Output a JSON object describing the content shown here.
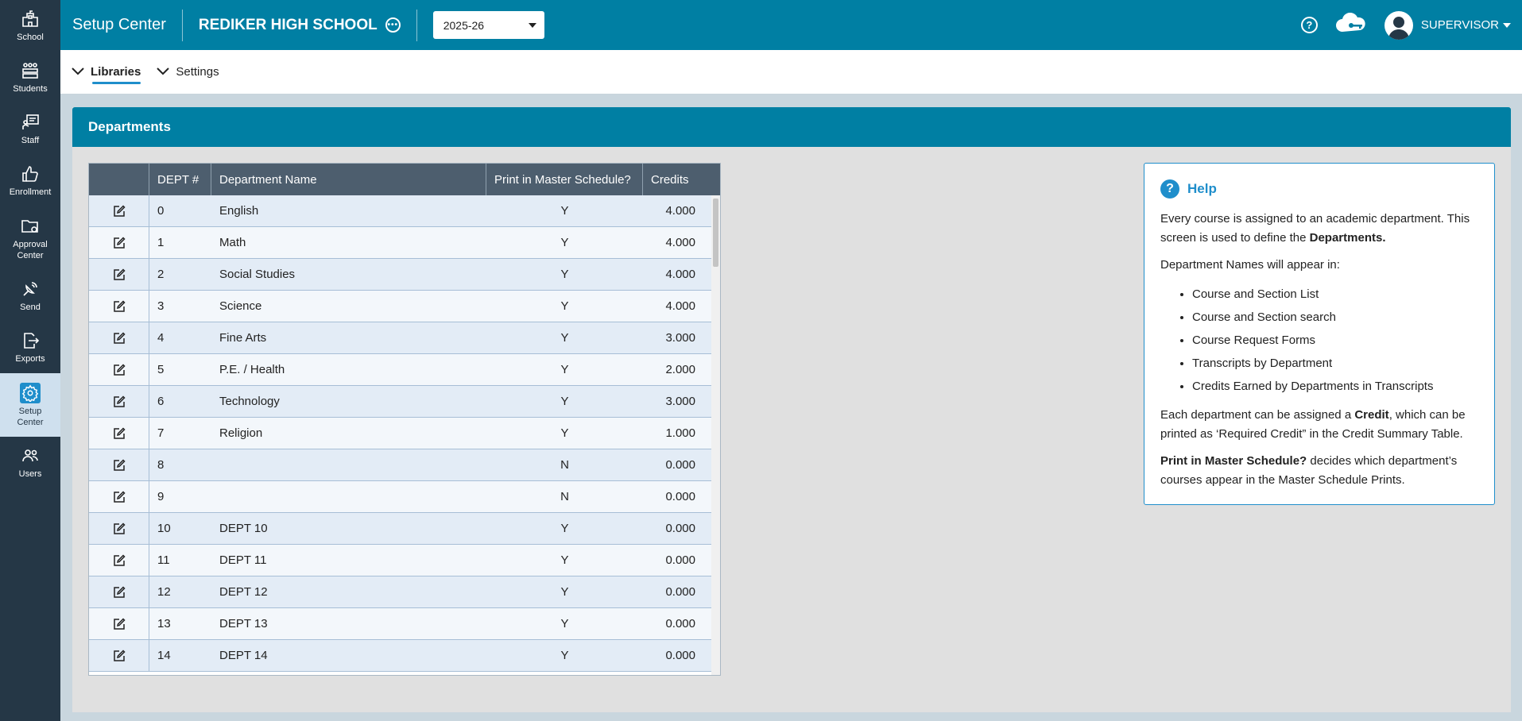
{
  "sidebar": {
    "items": [
      {
        "label": "School",
        "icon": "school-icon"
      },
      {
        "label": "Students",
        "icon": "students-icon"
      },
      {
        "label": "Staff",
        "icon": "staff-icon"
      },
      {
        "label": "Enrollment",
        "icon": "thumbs-up-icon"
      },
      {
        "label": "Approval Center",
        "icon": "folder-icon"
      },
      {
        "label": "Send",
        "icon": "satellite-icon"
      },
      {
        "label": "Exports",
        "icon": "export-icon"
      },
      {
        "label": "Setup Center",
        "icon": "gear-icon"
      },
      {
        "label": "Users",
        "icon": "users-icon"
      }
    ]
  },
  "topbar": {
    "app_title": "Setup Center",
    "school_name": "REDIKER HIGH SCHOOL",
    "year": "2025-26",
    "user": "SUPERVISOR"
  },
  "subnav": {
    "libraries": "Libraries",
    "settings": "Settings"
  },
  "panel": {
    "title": "Departments"
  },
  "table": {
    "columns": [
      "DEPT #",
      "Department Name",
      "Print in Master Schedule?",
      "Credits"
    ],
    "rows": [
      {
        "num": "0",
        "name": "English",
        "print": "Y",
        "credits": "4.000"
      },
      {
        "num": "1",
        "name": "Math",
        "print": "Y",
        "credits": "4.000"
      },
      {
        "num": "2",
        "name": "Social Studies",
        "print": "Y",
        "credits": "4.000"
      },
      {
        "num": "3",
        "name": "Science",
        "print": "Y",
        "credits": "4.000"
      },
      {
        "num": "4",
        "name": "Fine Arts",
        "print": "Y",
        "credits": "3.000"
      },
      {
        "num": "5",
        "name": "P.E. / Health",
        "print": "Y",
        "credits": "2.000"
      },
      {
        "num": "6",
        "name": "Technology",
        "print": "Y",
        "credits": "3.000"
      },
      {
        "num": "7",
        "name": "Religion",
        "print": "Y",
        "credits": "1.000"
      },
      {
        "num": "8",
        "name": "",
        "print": "N",
        "credits": "0.000"
      },
      {
        "num": "9",
        "name": "",
        "print": "N",
        "credits": "0.000"
      },
      {
        "num": "10",
        "name": "DEPT 10",
        "print": "Y",
        "credits": "0.000"
      },
      {
        "num": "11",
        "name": "DEPT 11",
        "print": "Y",
        "credits": "0.000"
      },
      {
        "num": "12",
        "name": "DEPT 12",
        "print": "Y",
        "credits": "0.000"
      },
      {
        "num": "13",
        "name": "DEPT 13",
        "print": "Y",
        "credits": "0.000"
      },
      {
        "num": "14",
        "name": "DEPT 14",
        "print": "Y",
        "credits": "0.000"
      }
    ]
  },
  "help": {
    "title": "Help",
    "p1_text": "Every course is assigned to an academic department. This screen is used to define the ",
    "p1_bold": "Departments.",
    "p2": "Department Names will appear in:",
    "list": [
      "Course and Section List",
      "Course and Section search",
      "Course Request Forms",
      "Transcripts by Department",
      "Credits Earned by Departments in Transcripts"
    ],
    "p3_a": "Each department can be assigned a ",
    "p3_bold": "Credit",
    "p3_b": ", which can be printed as ‘Required Credit” in the Credit Summary Table.",
    "p4_bold": "Print in Master Schedule?",
    "p4_text": " decides which department’s courses appear in the Master Schedule Prints."
  },
  "colors": {
    "topbar": "#007fa3",
    "sidebar": "#253746",
    "accent": "#1f8ecb",
    "table_header": "#4d5e6e"
  }
}
